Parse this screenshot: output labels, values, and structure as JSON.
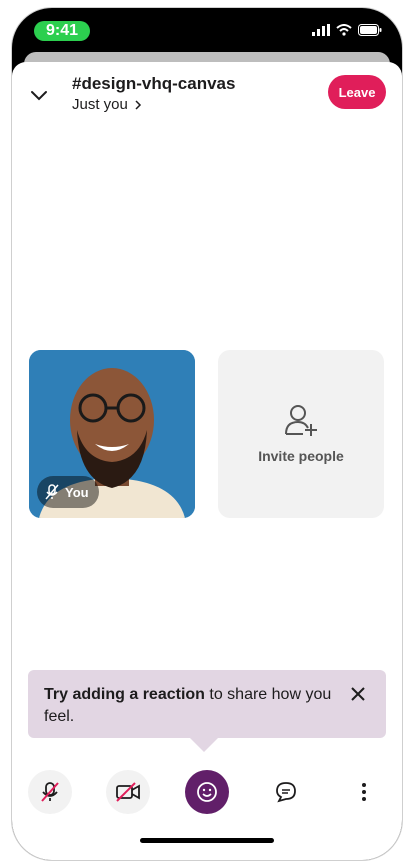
{
  "status_bar": {
    "time": "9:41"
  },
  "header": {
    "channel": "#design-vhq-canvas",
    "subtitle": "Just you",
    "leave_label": "Leave"
  },
  "participants": [
    {
      "label": "You"
    }
  ],
  "invite": {
    "label": "Invite people"
  },
  "tooltip": {
    "bold": "Try adding a reaction",
    "rest": " to share how you feel."
  },
  "controls": {
    "mic": "mic-off-icon",
    "video": "video-off-icon",
    "reaction": "emoji-icon",
    "chat": "chat-icon",
    "more": "more-icon"
  },
  "colors": {
    "accent": "#611f69",
    "leave": "#e01e5a",
    "time_pill": "#2ccf4f",
    "tooltip_bg": "#e2d6e3"
  }
}
